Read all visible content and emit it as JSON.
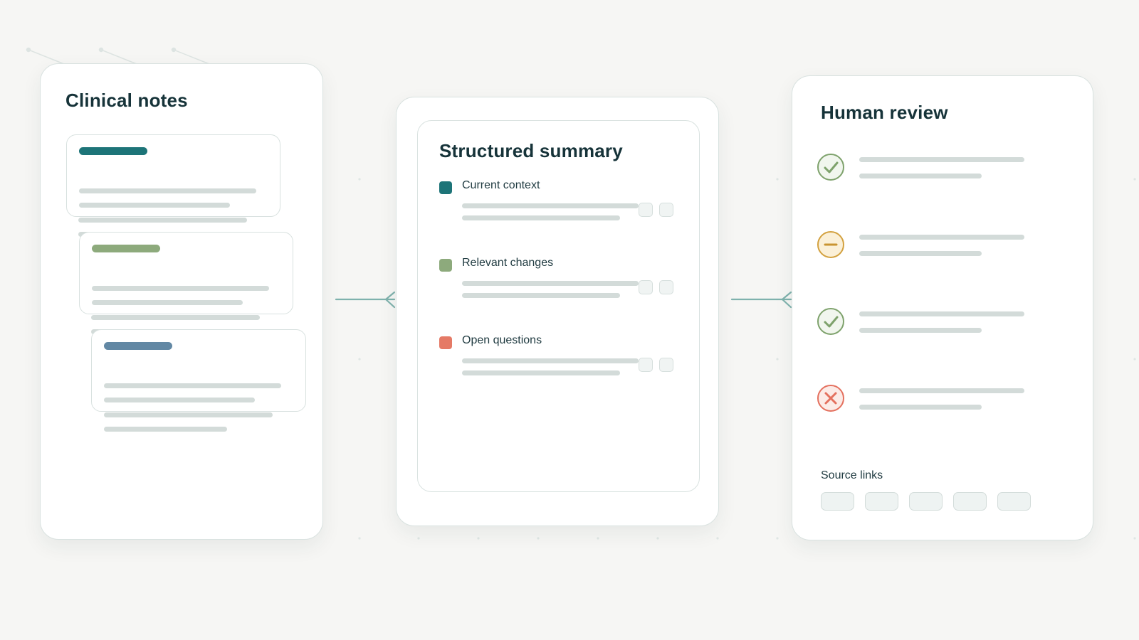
{
  "colors": {
    "teal": "#1d7478",
    "sage": "#8daa7c",
    "slate_blue": "#6288a4",
    "coral": "#e57a66",
    "check_green": "#7ea26c",
    "partial_amber": "#d3a13f",
    "reject_red": "#e4705e",
    "connector": "#7fb2ad"
  },
  "notes_panel": {
    "title": "Clinical notes",
    "cards": [
      {
        "tag_color": "#1d7478"
      },
      {
        "tag_color": "#8daa7c"
      },
      {
        "tag_color": "#6288a4"
      }
    ]
  },
  "summary_panel": {
    "title": "Structured summary",
    "sections": [
      {
        "label": "Current context",
        "color": "#1d7478"
      },
      {
        "label": "Relevant changes",
        "color": "#8daa7c"
      },
      {
        "label": "Open questions",
        "color": "#e57a66"
      }
    ]
  },
  "review_panel": {
    "title": "Human review",
    "items": [
      {
        "status": "approved",
        "icon": "check-circle-icon"
      },
      {
        "status": "partial",
        "icon": "minus-circle-icon"
      },
      {
        "status": "approved",
        "icon": "check-circle-icon"
      },
      {
        "status": "rejected",
        "icon": "x-circle-icon"
      }
    ],
    "source_label": "Source links",
    "source_link_count": 5
  }
}
